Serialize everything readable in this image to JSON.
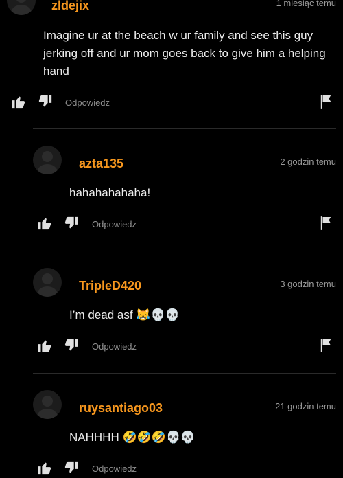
{
  "icons": {
    "like": "thumbs-up-icon",
    "dislike": "thumbs-down-icon",
    "flag": "flag-icon",
    "avatar": "user-avatar"
  },
  "colors": {
    "username": "#f7971e",
    "background": "#000000"
  },
  "comments": [
    {
      "username": "zldejix",
      "time": "1 miesiąc temu",
      "text": "Imagine ur at the beach w ur family and see this guy jerking off and ur mom goes back to give him a helping hand",
      "reply_label": "Odpowiedz"
    },
    {
      "username": "azta135",
      "time": "2 godzin temu",
      "text": "hahahahahaha!",
      "reply_label": "Odpowiedz"
    },
    {
      "username": "TripleD420",
      "time": "3 godzin temu",
      "text": "I’m dead asf 😹💀💀",
      "reply_label": "Odpowiedz"
    },
    {
      "username": "ruysantiago03",
      "time": "21 godzin temu",
      "text": "NAHHHH 🤣🤣🤣💀💀",
      "reply_label": "Odpowiedz"
    }
  ]
}
